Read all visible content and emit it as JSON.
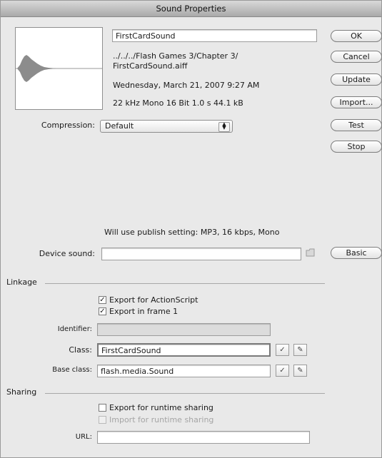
{
  "window": {
    "title": "Sound Properties"
  },
  "sound": {
    "name": "FirstCardSound",
    "path": "../../../Flash Games 3/Chapter 3/\nFirstCardSound.aiff",
    "path_line1": "../../../Flash Games 3/Chapter 3/",
    "path_line2": "FirstCardSound.aiff",
    "date": "Wednesday, March 21, 2007  9:27 AM",
    "format": "22 kHz Mono 16 Bit 1.0 s 44.1 kB"
  },
  "buttons": {
    "ok": "OK",
    "cancel": "Cancel",
    "update": "Update",
    "import": "Import...",
    "test": "Test",
    "stop": "Stop",
    "basic": "Basic"
  },
  "compression": {
    "label": "Compression:",
    "value": "Default"
  },
  "publish_note": "Will use publish setting: MP3, 16 kbps, Mono",
  "device_sound": {
    "label": "Device sound:",
    "value": ""
  },
  "linkage": {
    "heading": "Linkage",
    "export_actionscript": {
      "label": "Export for ActionScript",
      "checked": true
    },
    "export_frame1": {
      "label": "Export in frame 1",
      "checked": true
    },
    "identifier_label": "Identifier:",
    "identifier_value": "",
    "class_label": "Class:",
    "class_value": "FirstCardSound",
    "base_class_label": "Base class:",
    "base_class_value": "flash.media.Sound"
  },
  "sharing": {
    "heading": "Sharing",
    "export_runtime": {
      "label": "Export for runtime sharing",
      "checked": false
    },
    "import_runtime": {
      "label": "Import for runtime sharing",
      "checked": false
    },
    "url_label": "URL:",
    "url_value": ""
  },
  "icons": {
    "check": "checkmark-icon",
    "pencil": "pencil-icon",
    "folder": "folder-icon",
    "stepper": "updown-arrows-icon"
  }
}
